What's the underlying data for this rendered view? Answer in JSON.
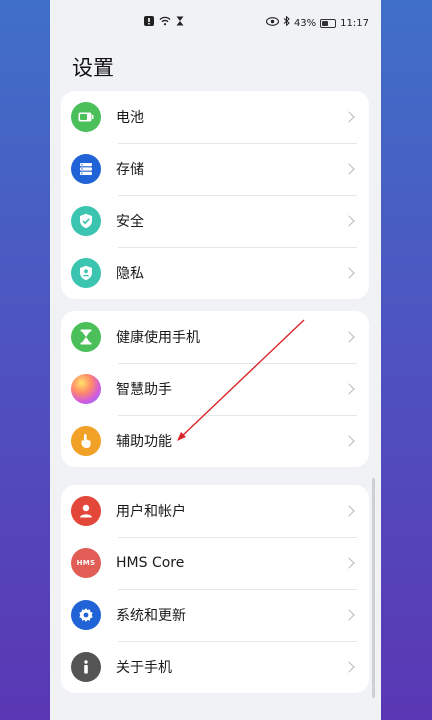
{
  "status": {
    "battery_pct": "43%",
    "time": "11:17",
    "left_icons": [
      "alert-icon",
      "wifi-icon",
      "hourglass-icon"
    ],
    "right_icons": [
      "eye-icon",
      "bluetooth-icon",
      "battery-icon"
    ]
  },
  "header": {
    "title": "设置"
  },
  "groups": [
    {
      "items": [
        {
          "label": "电池",
          "icon": "battery-icon",
          "color": "#4bbf5a"
        },
        {
          "label": "存储",
          "icon": "storage-icon",
          "color": "#1f63d6"
        },
        {
          "label": "安全",
          "icon": "shield-check-icon",
          "color": "#3bc4b0"
        },
        {
          "label": "隐私",
          "icon": "privacy-shield-icon",
          "color": "#3bc4b0"
        }
      ]
    },
    {
      "items": [
        {
          "label": "健康使用手机",
          "icon": "hourglass-icon",
          "color": "#4bbf5a"
        },
        {
          "label": "智慧助手",
          "icon": "assistant-orb-icon",
          "color": "#c86bd8"
        },
        {
          "label": "辅助功能",
          "icon": "hand-touch-icon",
          "color": "#f0a126"
        }
      ]
    },
    {
      "items": [
        {
          "label": "用户和帐户",
          "icon": "user-icon",
          "color": "#e2473a"
        },
        {
          "label": "HMS Core",
          "icon": "hms-icon",
          "icon_text": "HMS",
          "color": "#e25d55"
        },
        {
          "label": "系统和更新",
          "icon": "gear-icon",
          "color": "#1f63d6"
        },
        {
          "label": "关于手机",
          "icon": "info-icon",
          "color": "#545454"
        }
      ]
    }
  ],
  "annotation_color": "#d9262b"
}
